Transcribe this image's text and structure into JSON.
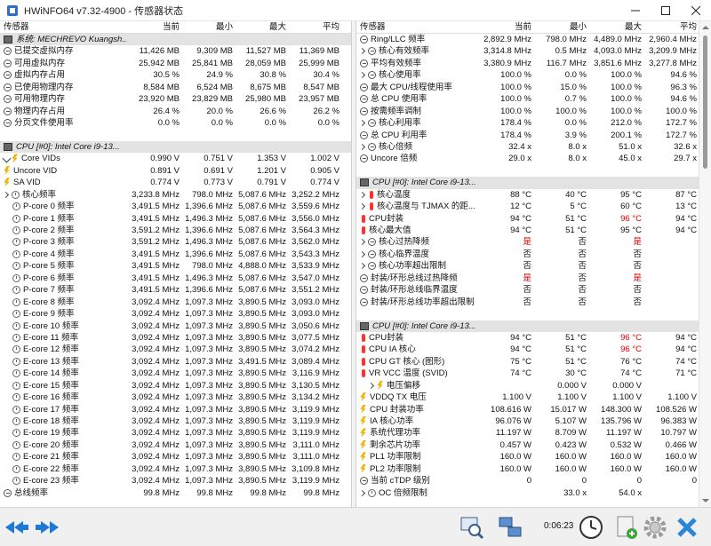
{
  "window": {
    "title": "HWiNFO64 v7.32-4900 - 传感器状态"
  },
  "columns": {
    "sensor": "传感器",
    "current": "当前",
    "min": "最小",
    "max": "最大",
    "avg": "平均"
  },
  "left_rows": [
    {
      "type": "group",
      "icon": "chip",
      "name": "系统: MECHREVO Kuangsh...",
      "c": "",
      "mi": "",
      "ma": "",
      "av": ""
    },
    {
      "type": "item",
      "icon": "minus",
      "name": "已提交虚拟内存",
      "c": "11,426 MB",
      "mi": "9,309 MB",
      "ma": "11,527 MB",
      "av": "11,369 MB"
    },
    {
      "type": "item",
      "icon": "minus",
      "name": "可用虚拟内存",
      "c": "25,942 MB",
      "mi": "25,841 MB",
      "ma": "28,059 MB",
      "av": "25,999 MB"
    },
    {
      "type": "item",
      "icon": "minus",
      "name": "虚拟内存占用",
      "c": "30.5 %",
      "mi": "24.9 %",
      "ma": "30.8 %",
      "av": "30.4 %"
    },
    {
      "type": "item",
      "icon": "minus",
      "name": "已使用物理内存",
      "c": "8,584 MB",
      "mi": "6,524 MB",
      "ma": "8,675 MB",
      "av": "8,547 MB"
    },
    {
      "type": "item",
      "icon": "minus",
      "name": "可用物理内存",
      "c": "23,920 MB",
      "mi": "23,829 MB",
      "ma": "25,980 MB",
      "av": "23,957 MB"
    },
    {
      "type": "item",
      "icon": "minus",
      "name": "物理内存占用",
      "c": "26.4 %",
      "mi": "20.0 %",
      "ma": "26.6 %",
      "av": "26.2 %"
    },
    {
      "type": "item",
      "icon": "minus",
      "name": "分页文件使用率",
      "c": "0.0 %",
      "mi": "0.0 %",
      "ma": "0.0 %",
      "av": "0.0 %"
    },
    {
      "type": "blank",
      "icon": "",
      "name": "",
      "c": "",
      "mi": "",
      "ma": "",
      "av": ""
    },
    {
      "type": "group",
      "icon": "chip",
      "name": "CPU [#0]: Intel Core i9-13...",
      "c": "",
      "mi": "",
      "ma": "",
      "av": ""
    },
    {
      "type": "item",
      "icon": "expand-bolt",
      "name": "Core VIDs",
      "c": "0.990 V",
      "mi": "0.751 V",
      "ma": "1.353 V",
      "av": "1.002 V"
    },
    {
      "type": "item",
      "icon": "bolt",
      "name": "Uncore VID",
      "c": "0.891 V",
      "mi": "0.691 V",
      "ma": "1.201 V",
      "av": "0.905 V"
    },
    {
      "type": "item",
      "icon": "bolt",
      "name": "SA VID",
      "c": "0.774 V",
      "mi": "0.773 V",
      "ma": "0.791 V",
      "av": "0.774 V"
    },
    {
      "type": "item",
      "icon": "chev-clock",
      "name": "核心频率",
      "c": "3,233.8 MHz",
      "mi": "798.0 MHz",
      "ma": "5,087.6 MHz",
      "av": "3,252.2 MHz"
    },
    {
      "type": "sub",
      "icon": "clock",
      "name": "P-core 0 频率",
      "c": "3,491.5 MHz",
      "mi": "1,396.6 MHz",
      "ma": "5,087.6 MHz",
      "av": "3,559.6 MHz"
    },
    {
      "type": "sub",
      "icon": "clock",
      "name": "P-core 1 频率",
      "c": "3,491.5 MHz",
      "mi": "1,496.3 MHz",
      "ma": "5,087.6 MHz",
      "av": "3,556.0 MHz"
    },
    {
      "type": "sub",
      "icon": "clock",
      "name": "P-core 2 频率",
      "c": "3,591.2 MHz",
      "mi": "1,396.6 MHz",
      "ma": "5,087.6 MHz",
      "av": "3,564.3 MHz"
    },
    {
      "type": "sub",
      "icon": "clock",
      "name": "P-core 3 频率",
      "c": "3,591.2 MHz",
      "mi": "1,496.3 MHz",
      "ma": "5,087.6 MHz",
      "av": "3,562.0 MHz"
    },
    {
      "type": "sub",
      "icon": "clock",
      "name": "P-core 4 频率",
      "c": "3,491.5 MHz",
      "mi": "1,396.6 MHz",
      "ma": "5,087.6 MHz",
      "av": "3,543.3 MHz"
    },
    {
      "type": "sub",
      "icon": "clock",
      "name": "P-core 5 频率",
      "c": "3,491.5 MHz",
      "mi": "798.0 MHz",
      "ma": "4,888.0 MHz",
      "av": "3,533.9 MHz"
    },
    {
      "type": "sub",
      "icon": "clock",
      "name": "P-core 6 频率",
      "c": "3,491.5 MHz",
      "mi": "1,496.3 MHz",
      "ma": "5,087.6 MHz",
      "av": "3,547.0 MHz"
    },
    {
      "type": "sub",
      "icon": "clock",
      "name": "P-core 7 频率",
      "c": "3,491.5 MHz",
      "mi": "1,396.6 MHz",
      "ma": "5,087.6 MHz",
      "av": "3,551.2 MHz"
    },
    {
      "type": "sub",
      "icon": "clock",
      "name": "E-core 8 频率",
      "c": "3,092.4 MHz",
      "mi": "1,097.3 MHz",
      "ma": "3,890.5 MHz",
      "av": "3,093.0 MHz"
    },
    {
      "type": "sub",
      "icon": "clock",
      "name": "E-core 9 频率",
      "c": "3,092.4 MHz",
      "mi": "1,097.3 MHz",
      "ma": "3,890.5 MHz",
      "av": "3,093.0 MHz"
    },
    {
      "type": "sub",
      "icon": "clock",
      "name": "E-core 10 频率",
      "c": "3,092.4 MHz",
      "mi": "1,097.3 MHz",
      "ma": "3,890.5 MHz",
      "av": "3,050.6 MHz"
    },
    {
      "type": "sub",
      "icon": "clock",
      "name": "E-core 11 频率",
      "c": "3,092.4 MHz",
      "mi": "1,097.3 MHz",
      "ma": "3,890.5 MHz",
      "av": "3,077.5 MHz"
    },
    {
      "type": "sub",
      "icon": "clock",
      "name": "E-core 12 频率",
      "c": "3,092.4 MHz",
      "mi": "1,097.3 MHz",
      "ma": "3,890.5 MHz",
      "av": "3,074.2 MHz"
    },
    {
      "type": "sub",
      "icon": "clock",
      "name": "E-core 13 频率",
      "c": "3,092.4 MHz",
      "mi": "1,097.3 MHz",
      "ma": "3,491.5 MHz",
      "av": "3,089.4 MHz"
    },
    {
      "type": "sub",
      "icon": "clock",
      "name": "E-core 14 频率",
      "c": "3,092.4 MHz",
      "mi": "1,097.3 MHz",
      "ma": "3,890.5 MHz",
      "av": "3,116.9 MHz"
    },
    {
      "type": "sub",
      "icon": "clock",
      "name": "E-core 15 频率",
      "c": "3,092.4 MHz",
      "mi": "1,097.3 MHz",
      "ma": "3,890.5 MHz",
      "av": "3,130.5 MHz"
    },
    {
      "type": "sub",
      "icon": "clock",
      "name": "E-core 16 频率",
      "c": "3,092.4 MHz",
      "mi": "1,097.3 MHz",
      "ma": "3,890.5 MHz",
      "av": "3,134.2 MHz"
    },
    {
      "type": "sub",
      "icon": "clock",
      "name": "E-core 17 频率",
      "c": "3,092.4 MHz",
      "mi": "1,097.3 MHz",
      "ma": "3,890.5 MHz",
      "av": "3,119.9 MHz"
    },
    {
      "type": "sub",
      "icon": "clock",
      "name": "E-core 18 频率",
      "c": "3,092.4 MHz",
      "mi": "1,097.3 MHz",
      "ma": "3,890.5 MHz",
      "av": "3,119.9 MHz"
    },
    {
      "type": "sub",
      "icon": "clock",
      "name": "E-core 19 频率",
      "c": "3,092.4 MHz",
      "mi": "1,097.3 MHz",
      "ma": "3,890.5 MHz",
      "av": "3,119.9 MHz"
    },
    {
      "type": "sub",
      "icon": "clock",
      "name": "E-core 20 频率",
      "c": "3,092.4 MHz",
      "mi": "1,097.3 MHz",
      "ma": "3,890.5 MHz",
      "av": "3,111.0 MHz"
    },
    {
      "type": "sub",
      "icon": "clock",
      "name": "E-core 21 频率",
      "c": "3,092.4 MHz",
      "mi": "1,097.3 MHz",
      "ma": "3,890.5 MHz",
      "av": "3,111.0 MHz"
    },
    {
      "type": "sub",
      "icon": "clock",
      "name": "E-core 22 频率",
      "c": "3,092.4 MHz",
      "mi": "1,097.3 MHz",
      "ma": "3,890.5 MHz",
      "av": "3,109.8 MHz"
    },
    {
      "type": "sub",
      "icon": "clock",
      "name": "E-core 23 频率",
      "c": "3,092.4 MHz",
      "mi": "1,097.3 MHz",
      "ma": "3,890.5 MHz",
      "av": "3,119.9 MHz"
    },
    {
      "type": "item",
      "icon": "minus",
      "name": "总线频率",
      "c": "99.8 MHz",
      "mi": "99.8 MHz",
      "ma": "99.8 MHz",
      "av": "99.8 MHz"
    }
  ],
  "right_rows": [
    {
      "type": "item",
      "icon": "minus",
      "name": "Ring/LLC 频率",
      "c": "2,892.9 MHz",
      "mi": "798.0 MHz",
      "ma": "4,489.0 MHz",
      "av": "2,960.4 MHz"
    },
    {
      "type": "item",
      "icon": "chev-minus",
      "name": "核心有效频率",
      "c": "3,314.8 MHz",
      "mi": "0.5 MHz",
      "ma": "4,093.0 MHz",
      "av": "3,209.9 MHz"
    },
    {
      "type": "item",
      "icon": "minus",
      "name": "平均有效频率",
      "c": "3,380.9 MHz",
      "mi": "116.7 MHz",
      "ma": "3,851.6 MHz",
      "av": "3,277.8 MHz"
    },
    {
      "type": "item",
      "icon": "chev-minus",
      "name": "核心使用率",
      "c": "100.0 %",
      "mi": "0.0 %",
      "ma": "100.0 %",
      "av": "94.6 %"
    },
    {
      "type": "item",
      "icon": "minus",
      "name": "最大 CPU/线程使用率",
      "c": "100.0 %",
      "mi": "15.0 %",
      "ma": "100.0 %",
      "av": "96.3 %"
    },
    {
      "type": "item",
      "icon": "minus",
      "name": "总 CPU 使用率",
      "c": "100.0 %",
      "mi": "0.7 %",
      "ma": "100.0 %",
      "av": "94.6 %"
    },
    {
      "type": "item",
      "icon": "minus",
      "name": "按需频率调制",
      "c": "100.0 %",
      "mi": "100.0 %",
      "ma": "100.0 %",
      "av": "100.0 %"
    },
    {
      "type": "item",
      "icon": "chev-minus",
      "name": "核心利用率",
      "c": "178.4 %",
      "mi": "0.0 %",
      "ma": "212.0 %",
      "av": "172.7 %"
    },
    {
      "type": "item",
      "icon": "minus",
      "name": "总 CPU 利用率",
      "c": "178.4 %",
      "mi": "3.9 %",
      "ma": "200.1 %",
      "av": "172.7 %"
    },
    {
      "type": "item",
      "icon": "chev-minus",
      "name": "核心倍频",
      "c": "32.4 x",
      "mi": "8.0 x",
      "ma": "51.0 x",
      "av": "32.6 x"
    },
    {
      "type": "item",
      "icon": "minus",
      "name": "Uncore 倍频",
      "c": "29.0 x",
      "mi": "8.0 x",
      "ma": "45.0 x",
      "av": "29.7 x"
    },
    {
      "type": "blank",
      "icon": "",
      "name": "",
      "c": "",
      "mi": "",
      "ma": "",
      "av": ""
    },
    {
      "type": "group",
      "icon": "chip",
      "name": "CPU [#0]: Intel Core i9-13...",
      "c": "",
      "mi": "",
      "ma": "",
      "av": ""
    },
    {
      "type": "item",
      "icon": "chev-therm",
      "name": "核心温度",
      "c": "88 °C",
      "mi": "40 °C",
      "ma": "95 °C",
      "av": "87 °C"
    },
    {
      "type": "item",
      "icon": "chev-therm",
      "name": "核心温度与 TJMAX 的距...",
      "c": "12 °C",
      "mi": "5 °C",
      "ma": "60 °C",
      "av": "13 °C"
    },
    {
      "type": "item",
      "icon": "therm",
      "name": "CPU封装",
      "c": "94 °C",
      "mi": "51 °C",
      "ma": "96 °C",
      "av": "94 °C",
      "maRed": true
    },
    {
      "type": "item",
      "icon": "therm",
      "name": "核心最大值",
      "c": "94 °C",
      "mi": "51 °C",
      "ma": "95 °C",
      "av": "94 °C"
    },
    {
      "type": "item",
      "icon": "chev-minus",
      "name": "核心过热降频",
      "c": "是",
      "mi": "否",
      "ma": "是",
      "av": "",
      "cRed": true,
      "maRed": true
    },
    {
      "type": "item",
      "icon": "chev-minus",
      "name": "核心临界温度",
      "c": "否",
      "mi": "否",
      "ma": "否",
      "av": ""
    },
    {
      "type": "item",
      "icon": "chev-minus",
      "name": "核心功率超出限制",
      "c": "否",
      "mi": "否",
      "ma": "否",
      "av": ""
    },
    {
      "type": "item",
      "icon": "minus",
      "name": "封装/环形总线过热降频",
      "c": "是",
      "mi": "否",
      "ma": "是",
      "av": "",
      "cRed": true,
      "maRed": true
    },
    {
      "type": "item",
      "icon": "minus",
      "name": "封装/环形总线临界温度",
      "c": "否",
      "mi": "否",
      "ma": "否",
      "av": ""
    },
    {
      "type": "item",
      "icon": "minus",
      "name": "封装/环形总线功率超出限制",
      "c": "否",
      "mi": "否",
      "ma": "否",
      "av": ""
    },
    {
      "type": "blank",
      "icon": "",
      "name": "",
      "c": "",
      "mi": "",
      "ma": "",
      "av": ""
    },
    {
      "type": "group",
      "icon": "chip",
      "name": "CPU [#0]: Intel Core i9-13...",
      "c": "",
      "mi": "",
      "ma": "",
      "av": ""
    },
    {
      "type": "item",
      "icon": "therm",
      "name": "CPU封装",
      "c": "94 °C",
      "mi": "51 °C",
      "ma": "96 °C",
      "av": "94 °C",
      "maRed": true
    },
    {
      "type": "item",
      "icon": "therm",
      "name": "CPU IA 核心",
      "c": "94 °C",
      "mi": "51 °C",
      "ma": "96 °C",
      "av": "94 °C",
      "maRed": true
    },
    {
      "type": "item",
      "icon": "therm",
      "name": "CPU GT 核心 (图形)",
      "c": "75 °C",
      "mi": "51 °C",
      "ma": "76 °C",
      "av": "74 °C"
    },
    {
      "type": "item",
      "icon": "therm",
      "name": "VR VCC 温度 (SVID)",
      "c": "74 °C",
      "mi": "30 °C",
      "ma": "74 °C",
      "av": "71 °C"
    },
    {
      "type": "sub",
      "icon": "chev-bolt",
      "name": "电压偏移",
      "c": "",
      "mi": "0.000 V",
      "ma": "0.000 V",
      "av": ""
    },
    {
      "type": "item",
      "icon": "bolt",
      "name": "VDDQ TX 电压",
      "c": "1.100 V",
      "mi": "1.100 V",
      "ma": "1.100 V",
      "av": "1.100 V"
    },
    {
      "type": "item",
      "icon": "bolt",
      "name": "CPU 封装功率",
      "c": "108.616 W",
      "mi": "15.017 W",
      "ma": "148.300 W",
      "av": "108.526 W"
    },
    {
      "type": "item",
      "icon": "bolt",
      "name": "IA 核心功率",
      "c": "96.076 W",
      "mi": "5.107 W",
      "ma": "135.796 W",
      "av": "96.383 W"
    },
    {
      "type": "item",
      "icon": "bolt",
      "name": "系统代理功率",
      "c": "11.197 W",
      "mi": "8.709 W",
      "ma": "11.197 W",
      "av": "10.797 W"
    },
    {
      "type": "item",
      "icon": "bolt",
      "name": "剩余芯片功率",
      "c": "0.457 W",
      "mi": "0.423 W",
      "ma": "0.532 W",
      "av": "0.466 W"
    },
    {
      "type": "item",
      "icon": "bolt",
      "name": "PL1 功率限制",
      "c": "160.0 W",
      "mi": "160.0 W",
      "ma": "160.0 W",
      "av": "160.0 W"
    },
    {
      "type": "item",
      "icon": "bolt",
      "name": "PL2 功率限制",
      "c": "160.0 W",
      "mi": "160.0 W",
      "ma": "160.0 W",
      "av": "160.0 W"
    },
    {
      "type": "item",
      "icon": "minus",
      "name": "当前 cTDP 级别",
      "c": "0",
      "mi": "0",
      "ma": "0",
      "av": "0"
    },
    {
      "type": "item",
      "icon": "chev-clock",
      "name": "OC 倍频限制",
      "c": "",
      "mi": "33.0 x",
      "ma": "54.0 x",
      "av": ""
    }
  ],
  "status": {
    "timer": "0:06:23"
  },
  "colors": {
    "group_bg": "#e3e3e3",
    "alert": "#e00000",
    "nav_arrow": "#1e78d8"
  }
}
